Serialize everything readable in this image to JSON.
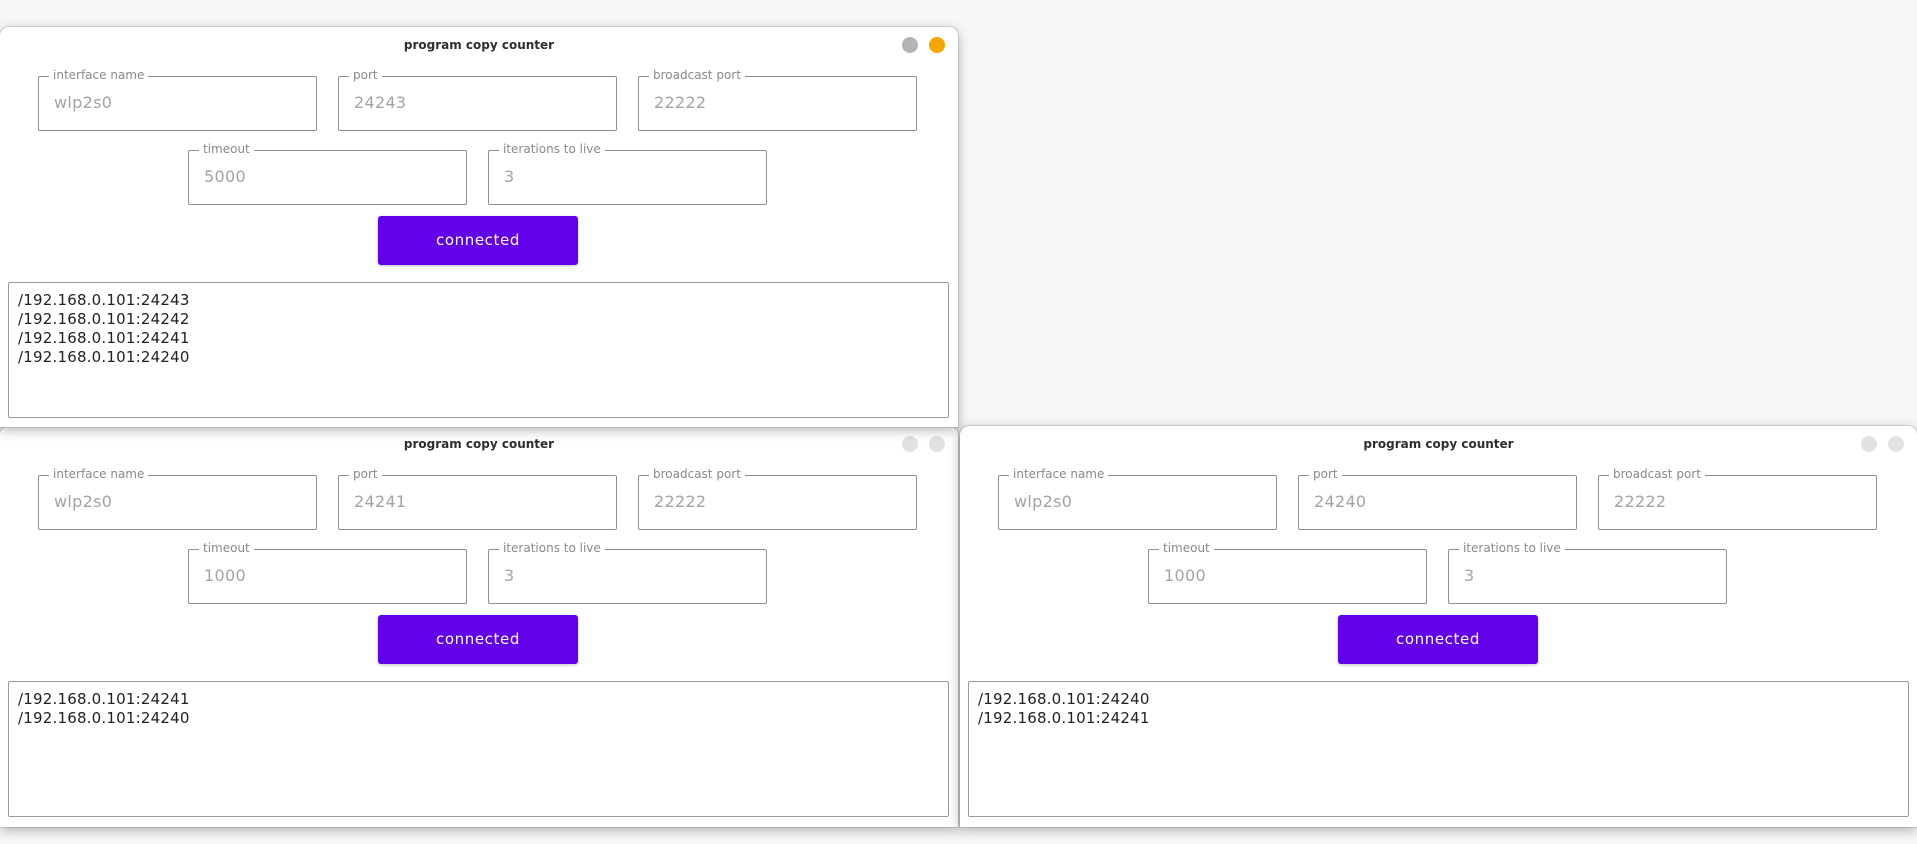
{
  "windows": [
    {
      "title": "program copy counter",
      "fields": {
        "interface_name": {
          "label": "interface name",
          "value": "wlp2s0"
        },
        "port": {
          "label": "port",
          "value": "24243"
        },
        "broadcast_port": {
          "label": "broadcast port",
          "value": "22222"
        },
        "timeout": {
          "label": "timeout",
          "value": "5000"
        },
        "iterations": {
          "label": "iterations to live",
          "value": "3"
        }
      },
      "button_label": "connected",
      "log": [
        "/192.168.0.101:24243",
        "/192.168.0.101:24242",
        "/192.168.0.101:24241",
        "/192.168.0.101:24240"
      ]
    },
    {
      "title": "program copy counter",
      "fields": {
        "interface_name": {
          "label": "interface name",
          "value": "wlp2s0"
        },
        "port": {
          "label": "port",
          "value": "24241"
        },
        "broadcast_port": {
          "label": "broadcast port",
          "value": "22222"
        },
        "timeout": {
          "label": "timeout",
          "value": "1000"
        },
        "iterations": {
          "label": "iterations to live",
          "value": "3"
        }
      },
      "button_label": "connected",
      "log": [
        "/192.168.0.101:24241",
        "/192.168.0.101:24240"
      ]
    },
    {
      "title": "program copy counter",
      "fields": {
        "interface_name": {
          "label": "interface name",
          "value": "wlp2s0"
        },
        "port": {
          "label": "port",
          "value": "24240"
        },
        "broadcast_port": {
          "label": "broadcast port",
          "value": "22222"
        },
        "timeout": {
          "label": "timeout",
          "value": "1000"
        },
        "iterations": {
          "label": "iterations to live",
          "value": "3"
        }
      },
      "button_label": "connected",
      "log": [
        "/192.168.0.101:24240",
        "/192.168.0.101:24241"
      ]
    }
  ],
  "colors": {
    "accent": "#6200ea",
    "close_active": "#f5a700",
    "minimize_active": "#b4b4b4",
    "control_inactive": "#e2e2e2"
  },
  "icons": {
    "minimize": "minimize-icon",
    "close": "close-icon"
  }
}
